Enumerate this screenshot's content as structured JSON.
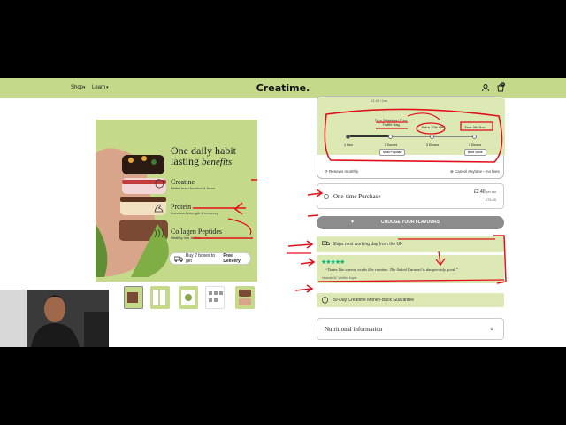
{
  "nav": {
    "shop": "Shop",
    "learn": "Learn",
    "logo": "Creatime.",
    "cart_count": "0"
  },
  "hero": {
    "headline_line1": "One daily habit",
    "headline_line2": "lasting",
    "headline_em": "benefits",
    "features": [
      {
        "title": "Creatine",
        "sub": "Better brain function & focus"
      },
      {
        "title": "Protein",
        "sub": "Increased strength & recovery"
      },
      {
        "title": "Collagen Peptides",
        "sub": "Healthy hair & Skin"
      }
    ],
    "cta_prefix": "Buy 2 boxes to get ",
    "cta_bold": "Free Delivery"
  },
  "plan": {
    "price_top": "£2.40 / bar",
    "steps": [
      {
        "label": "1 Box",
        "top": "",
        "badge": ""
      },
      {
        "label": "2 Boxes",
        "top": "Free Shipping / Free Truffle Bag",
        "badge": "Most Popular"
      },
      {
        "label": "3 Boxes",
        "top": "Extra 10% Off",
        "badge": ""
      },
      {
        "label": "4 Boxes",
        "top": "Free 5th Box",
        "badge": "Best Value"
      }
    ],
    "renews": "Renews monthly",
    "cancel": "Cancel anytime – no fees"
  },
  "onetime": {
    "label": "One-time Purchase",
    "price": "£2.40",
    "per": "per bar",
    "total": "£76.80"
  },
  "choose_button": "CHOOSE YOUR FLAVOURS",
  "ships": "Ships next working day from the UK",
  "review": {
    "quote": "“Tastes like a treat, works like creatine. The Salted Caramel is dangerously good.”",
    "author": "Hannah W.  Verified buyer",
    "stars": "★★★★★"
  },
  "guarantee": "30-Day Creatime Money-Back Guarantee",
  "nutrition": "Nutritional information",
  "colors": {
    "brand_green": "#c5d98a",
    "light_green": "#dde9b5",
    "annotation_red": "#e0101a",
    "trustpilot": "#00b67a"
  }
}
